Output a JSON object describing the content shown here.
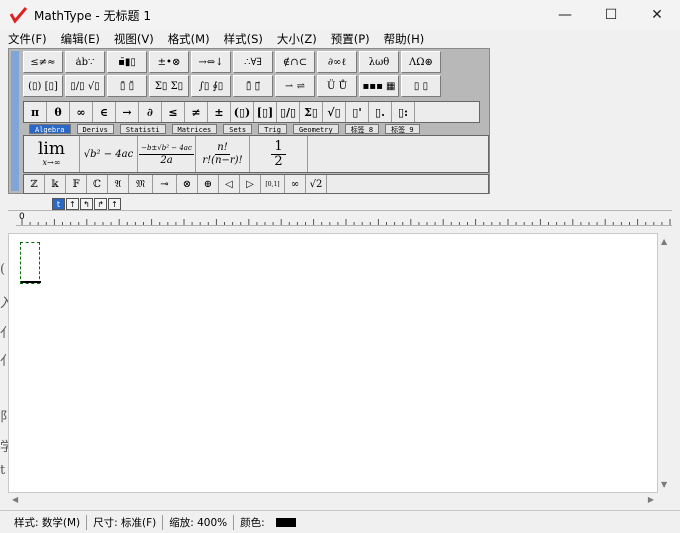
{
  "window": {
    "app_name": "MathType",
    "title": "MathType - 无标题 1",
    "minimize": "—",
    "maximize": "☐",
    "close": "✕"
  },
  "menu": [
    "文件(F)",
    "编辑(E)",
    "视图(V)",
    "格式(M)",
    "样式(S)",
    "大小(Z)",
    "预置(P)",
    "帮助(H)"
  ],
  "palettes_row1": [
    "≤≠≈",
    "ȧb∵",
    "▪̄▮▯",
    "±•⊗",
    "→⇔↓",
    "∴∀∃",
    "∉∩⊂",
    "∂∞ℓ",
    "λωθ",
    "ΛΩ⊛"
  ],
  "palettes_row2": [
    "(▯) [▯]",
    "▯/▯ √▯",
    "▯̄ ▯̆",
    "Σ▯ Σ▯",
    "∫▯ ∮▯",
    "▯̄ ▯⃗",
    "⇀ ⇌",
    "Ü Ů",
    "▪▪▪ ▦",
    "▯ ▯"
  ],
  "symbols": [
    "π",
    "θ",
    "∞",
    "∈",
    "→",
    "∂",
    "≤",
    "≠",
    "±",
    "(▯)",
    "[▯]",
    "▯/▯",
    "Σ▯",
    "√▯",
    "▯'",
    "▯.",
    "▯:"
  ],
  "tabs": [
    "Algebra",
    "Derivs",
    "Statisti",
    "Matrices",
    "Sets",
    "Trig",
    "Geometry",
    "标签 8",
    "标签 9"
  ],
  "active_tab": "Algebra",
  "templates": {
    "lim_big": "lim",
    "lim_sub": "x→∞",
    "sqrt": "√b² − 4ac",
    "quadratic_num": "−b±√b² − 4ac",
    "quadratic_den": "2a",
    "comb_num": "n!",
    "comb_den": "r!(n−r)!",
    "half_num": "1",
    "half_den": "2"
  },
  "small_symbols": [
    "ℤ",
    "𝕜",
    "𝔽",
    "ℂ",
    "𝔄",
    "𝔐",
    "⊸",
    "⊗",
    "⊕",
    "◁",
    "▷",
    "[0,1]",
    "∞",
    "√2"
  ],
  "style_buttons": [
    "t",
    "↑",
    "↰",
    "↱",
    "↑"
  ],
  "ruler": {
    "zero": "0"
  },
  "behind_fragments": [
    "(",
    "入",
    "亻",
    "亻",
    "阝",
    "学",
    "t"
  ],
  "status": {
    "style": "样式: 数学(M)",
    "size": "尺寸: 标准(F)",
    "zoom": "缩放: 400%",
    "color_label": "颜色:",
    "color_value": "#000000"
  }
}
